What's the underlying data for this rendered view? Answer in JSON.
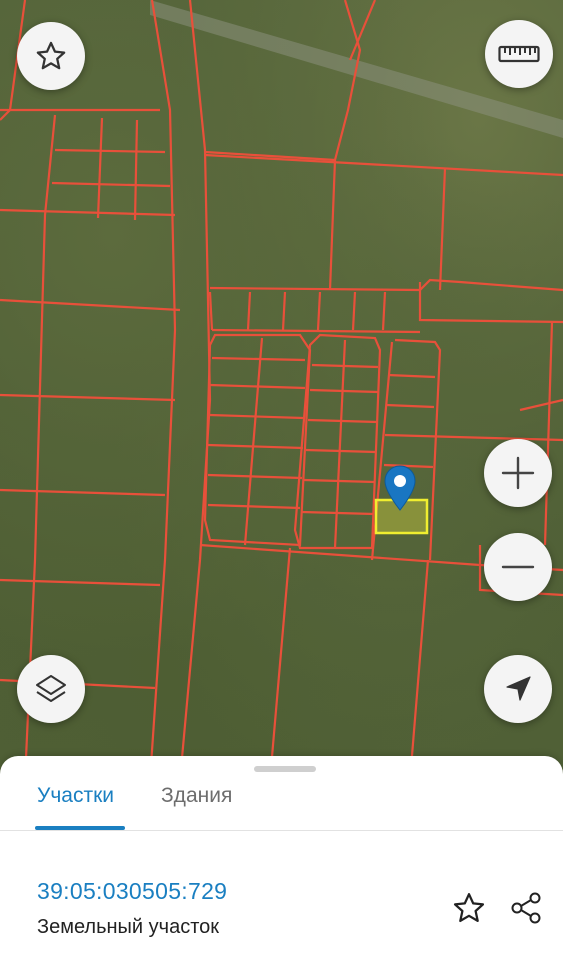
{
  "map": {
    "satellite": true,
    "parcel_line_color": "#e8503a",
    "selected_parcel_fill": "#e8e640",
    "marker_color": "#1976c2"
  },
  "controls": {
    "favorite": "star-icon",
    "ruler": "ruler-icon",
    "zoom_in": "plus-icon",
    "zoom_out": "minus-icon",
    "layers": "layers-icon",
    "locate": "navigation-arrow-icon"
  },
  "sheet": {
    "tabs": [
      {
        "label": "Участки",
        "active": true
      },
      {
        "label": "Здания",
        "active": false
      }
    ],
    "parcel": {
      "cadastral_number": "39:05:030505:729",
      "type": "Земельный участок"
    },
    "accent": "#1a7fc1"
  }
}
